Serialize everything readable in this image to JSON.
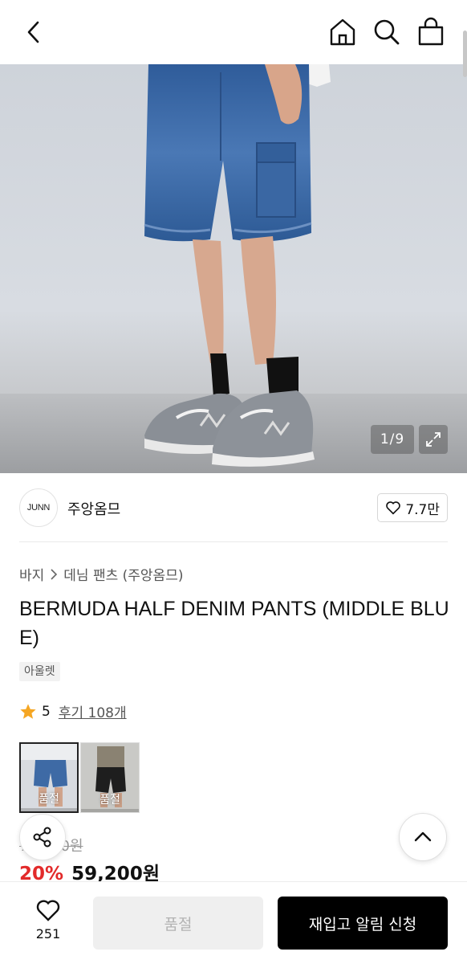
{
  "header": {
    "back_icon": "chevron-left-icon",
    "home_icon": "home-icon",
    "search_icon": "search-icon",
    "cart_icon": "shopping-bag-icon"
  },
  "gallery": {
    "counter": "1/9",
    "expand_icon": "expand-icon"
  },
  "brand": {
    "logo_text": "JUNN",
    "name": "주앙옴므",
    "like_count": "7.7만"
  },
  "breadcrumb": {
    "category": "바지",
    "subcategory": "데님 팬츠 (주앙옴므)"
  },
  "product": {
    "title": "BERMUDA HALF DENIM PANTS (MIDDLE BLUE)",
    "tag": "아울렛",
    "rating": "5",
    "reviews": "후기 108개",
    "original_price": "74,000원",
    "discount": "20%",
    "price": "59,200원"
  },
  "options": [
    {
      "label": "품절",
      "color": "#3e6aa5"
    },
    {
      "label": "품절",
      "color": "#1e1e1e"
    }
  ],
  "bottom_bar": {
    "wish_count": "251",
    "soldout_label": "품절",
    "restock_label": "재입고 알림 신청"
  },
  "colors": {
    "discount_red": "#e22a2a",
    "star_orange": "#f5a623",
    "primary_black": "#000000"
  }
}
